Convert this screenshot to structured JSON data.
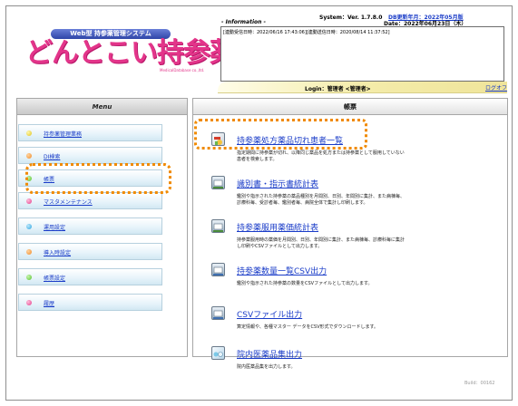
{
  "app": {
    "system_name": "Web型 持参薬管理システム",
    "logo_text": "どんとこい持参薬",
    "logo_sub": "MedicalDatabase co.,ltd.",
    "system_version": "System：Ver. 1.7.8.0",
    "db_update": "DB更新年月：2022年05月版",
    "info_label": "- Information -",
    "date_label": "Date：2022年06月23日（木）",
    "info_text": "[連動受信日時：2022/06/16 17:43:06][連動送信日時：2020/08/14 11:37:52]",
    "login_text": "Login：管理者 <管理者>",
    "logout_label": "ログオフ",
    "build": "Build：00162"
  },
  "menu": {
    "title": "Menu",
    "items": [
      {
        "label": "持参薬管理業務",
        "color": "#e0c21a"
      },
      {
        "label": "DI検索",
        "color": "#f08a28"
      },
      {
        "label": "帳票",
        "color": "#56c12b"
      },
      {
        "label": "マスタメンテナンス",
        "color": "#e43b8a"
      },
      {
        "label": "運用設定",
        "color": "#29a4e0"
      },
      {
        "label": "導入時設定",
        "color": "#f08a28"
      },
      {
        "label": "帳票設定",
        "color": "#56c12b"
      },
      {
        "label": "履歴",
        "color": "#e43b8a"
      }
    ]
  },
  "reports": {
    "title": "帳票",
    "items": [
      {
        "title": "持参薬処方薬品切れ患者一覧",
        "desc": [
          "指定期間に持参薬が切れ、以降同じ薬品を処方または持参薬として服用していない",
          "患者を検索します。"
        ],
        "icon": "pill-report-icon"
      },
      {
        "title": "識別書・指示書統計表",
        "desc": [
          "鑑別や指示された持参薬の薬品種別を月間別、日別、年間別に集計、また病棟毎、",
          "診療科毎、受診者毎、鑑別者毎、病院全体で集計し印刷します。"
        ],
        "icon": "statistics-report-icon"
      },
      {
        "title": "持参薬服用薬価統計表",
        "desc": [
          "持参薬服用時の薬価を月間別、日別、年間別に集計、また病棟毎、診療科毎に集計",
          "し印刷やCSVファイルとして出力します。"
        ],
        "icon": "price-report-icon"
      },
      {
        "title": "持参薬数量一覧CSV出力",
        "desc": [
          "鑑別や指示された持参薬の数量をCSVファイルとして出力します。"
        ],
        "icon": "quantity-csv-icon"
      },
      {
        "title": "CSVファイル出力",
        "desc": [
          "算定情報や、各種マスター データをCSV形式でダウンロードします。"
        ],
        "icon": "csv-file-icon"
      },
      {
        "title": "院内医薬品集出力",
        "desc": [
          "院内医薬品集を出力します。"
        ],
        "icon": "formulary-icon"
      }
    ]
  }
}
